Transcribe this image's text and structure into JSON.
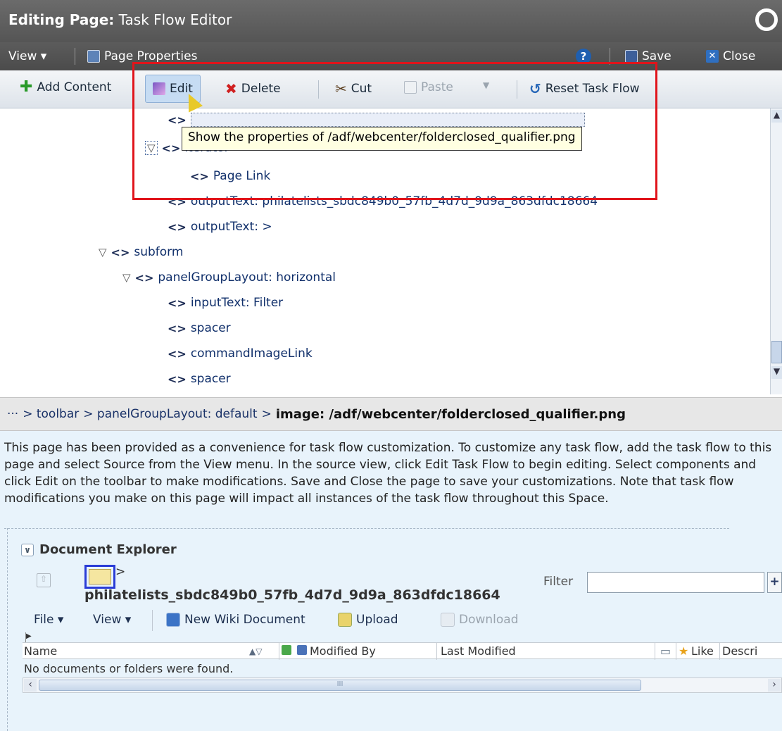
{
  "title": {
    "prefix": "Editing Page:",
    "name": "Task Flow Editor"
  },
  "menubar": {
    "view": "View ▾",
    "page_properties": "Page Properties",
    "save": "Save",
    "close": "Close"
  },
  "toolbar": {
    "add_content": "Add Content",
    "edit": "Edit",
    "delete": "Delete",
    "cut": "Cut",
    "paste": "Paste",
    "reset": "Reset Task Flow"
  },
  "tooltip": "Show the properties of /adf/webcenter/folderclosed_qualifier.png",
  "tree": [
    {
      "label": "iterator",
      "expanded": true
    },
    {
      "label": "Page Link"
    },
    {
      "label": "outputText: philatelists_sbdc849b0_57fb_4d7d_9d9a_863dfdc18664"
    },
    {
      "label": "outputText: >"
    },
    {
      "label": "subform",
      "expanded": true
    },
    {
      "label": "panelGroupLayout: horizontal",
      "expanded": true
    },
    {
      "label": "inputText: Filter"
    },
    {
      "label": "spacer"
    },
    {
      "label": "commandImageLink"
    },
    {
      "label": "spacer"
    }
  ],
  "breadcrumb": {
    "ellipsis": "···",
    "toolbar": "> toolbar",
    "layout": "> panelGroupLayout: default",
    "sep": ">",
    "current": "image: /adf/webcenter/folderclosed_qualifier.png"
  },
  "info_text": "This page has been provided as a convenience for task flow customization. To customize any task flow, add the task flow to this page and select Source from the View menu. In the source view, click Edit Task Flow to begin editing. Select components and click Edit on the toolbar to make modifications. Save and Close the page to save your customizations. Note that task flow modifications you make on this page will impact all instances of the task flow throughout this Space.",
  "explorer": {
    "title": "Document Explorer",
    "gt": ">",
    "folder_name": "philatelists_sbdc849b0_57fb_4d7d_9d9a_863dfdc18664",
    "filter_label": "Filter",
    "filter_value": "",
    "menus": {
      "file": "File ▾",
      "view": "View ▾"
    },
    "actions": {
      "new_wiki": "New Wiki Document",
      "upload": "Upload",
      "download": "Download"
    },
    "columns": {
      "name": "Name",
      "modified_by": "Modified By",
      "last_modified": "Last Modified",
      "like": "Like",
      "description": "Descri"
    },
    "empty_message": "No documents or folders were found.",
    "scroll_mark": "III"
  }
}
